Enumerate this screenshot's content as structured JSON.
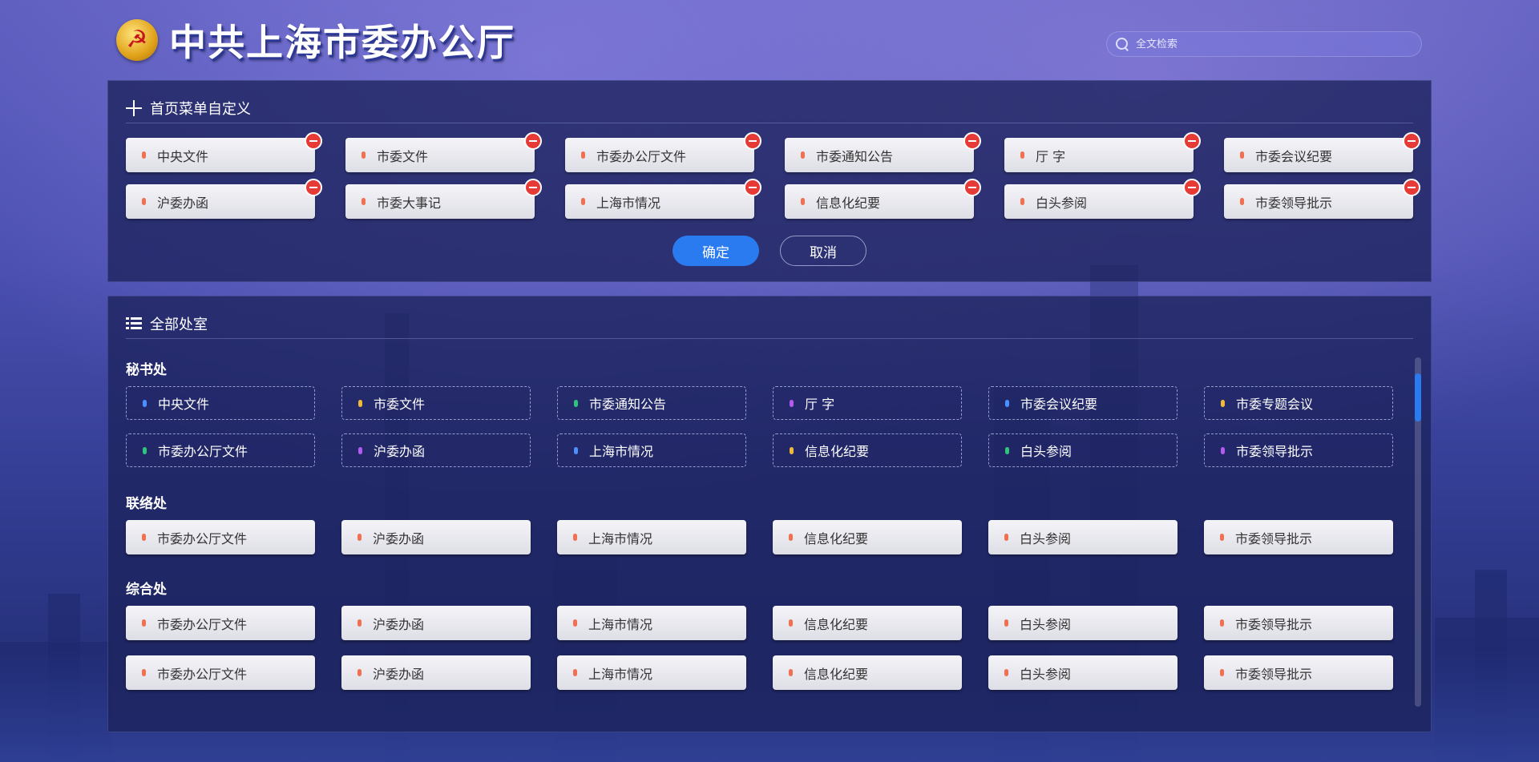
{
  "header": {
    "title": "中共上海市委办公厅",
    "emblem_icon": "party-emblem-icon",
    "search": {
      "placeholder": "全文检索"
    }
  },
  "custom_menu": {
    "title": "首页菜单自定义",
    "items": [
      "中央文件",
      "市委文件",
      "市委办公厅文件",
      "市委通知公告",
      "厅  字",
      "市委会议纪要",
      "沪委办函",
      "市委大事记",
      "上海市情况",
      "信息化纪要",
      "白头参阅",
      "市委领导批示"
    ],
    "confirm_label": "确定",
    "cancel_label": "取消"
  },
  "all_offices": {
    "title": "全部处室",
    "sections": [
      {
        "name": "秘书处",
        "items": [
          {
            "label": "中央文件",
            "color": "#4a90ff"
          },
          {
            "label": "市委文件",
            "color": "#f0b93a"
          },
          {
            "label": "市委通知公告",
            "color": "#2fc47a"
          },
          {
            "label": "厅  字",
            "color": "#b25bf0"
          },
          {
            "label": "市委会议纪要",
            "color": "#4a90ff"
          },
          {
            "label": "市委专题会议",
            "color": "#f0b93a"
          },
          {
            "label": "市委办公厅文件",
            "color": "#2fc47a"
          },
          {
            "label": "沪委办函",
            "color": "#b25bf0"
          },
          {
            "label": "上海市情况",
            "color": "#4a90ff"
          },
          {
            "label": "信息化纪要",
            "color": "#f0b93a"
          },
          {
            "label": "白头参阅",
            "color": "#2fc47a"
          },
          {
            "label": "市委领导批示",
            "color": "#b25bf0"
          }
        ]
      },
      {
        "name": "联络处",
        "items": [
          "市委办公厅文件",
          "沪委办函",
          "上海市情况",
          "信息化纪要",
          "白头参阅",
          "市委领导批示"
        ]
      },
      {
        "name": "综合处",
        "items": [
          "市委办公厅文件",
          "沪委办函",
          "上海市情况",
          "信息化纪要",
          "白头参阅",
          "市委领导批示",
          "市委办公厅文件",
          "沪委办函",
          "上海市情况",
          "信息化纪要",
          "白头参阅",
          "市委领导批示"
        ]
      }
    ]
  },
  "colors": {
    "accent": "#2a7bf0",
    "remove": "#e53a36",
    "tile_dot": "#f07050"
  }
}
